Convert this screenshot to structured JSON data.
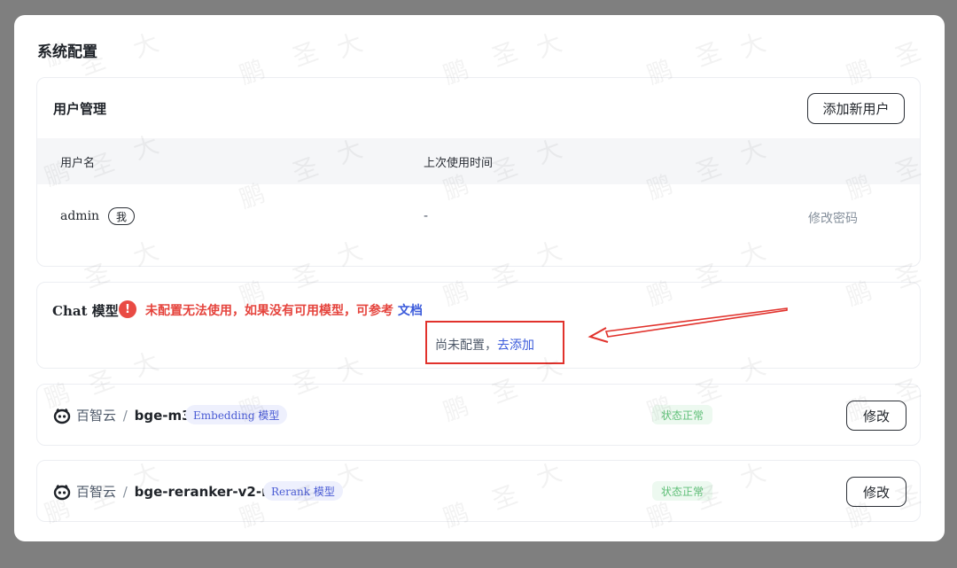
{
  "page": {
    "title": "系统配置"
  },
  "users": {
    "title": "用户管理",
    "add_button": "添加新用户",
    "columns": [
      "用户名",
      "上次使用时间"
    ],
    "rows": [
      {
        "username": "admin",
        "badge": "我",
        "last_used": "-",
        "action": "修改密码"
      }
    ]
  },
  "chat": {
    "label": "Chat 模型",
    "warning": "未配置无法使用，如果没有可用模型，可参考",
    "doc_link": "文档",
    "not_configured": "尚未配置，",
    "add_link": "去添加"
  },
  "models": [
    {
      "provider": "百智云",
      "separator": "/",
      "name": "bge-m3",
      "tag": "Embedding 模型",
      "status": "状态正常",
      "edit": "修改"
    },
    {
      "provider": "百智云",
      "separator": "/",
      "name": "bge-reranker-v2-m3",
      "tag": "Rerank 模型",
      "status": "状态正常",
      "edit": "修改"
    }
  ],
  "watermark": [
    "鹏",
    "大",
    "圣"
  ],
  "colors": {
    "warning": "#e5443d",
    "link": "#3b5bdb",
    "status_ok": "#5fbf77",
    "annotation": "#e1322c"
  }
}
